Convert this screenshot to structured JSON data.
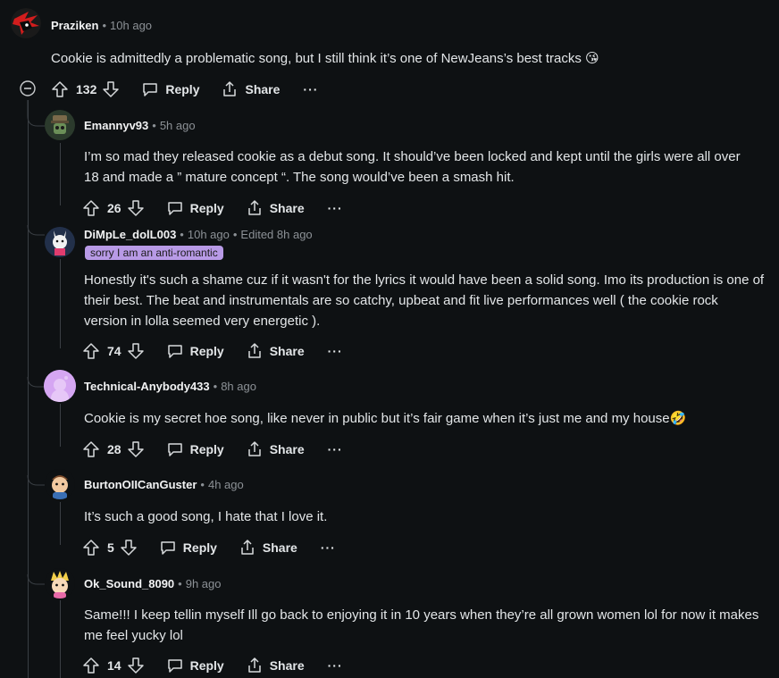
{
  "comments": [
    {
      "username": "Praziken",
      "time": "10h ago",
      "text": "Cookie is admittedly a problematic song, but I still think it’s one of NewJeans’s best tracks 😘",
      "votes": "132",
      "reply": "Reply",
      "share": "Share",
      "more": "···"
    },
    {
      "username": "Emannyv93",
      "time": "5h ago",
      "text": "I’m so mad they released cookie as a debut song. It should’ve been locked and kept until the girls were all over 18 and made a ” mature concept “. The song would’ve been a smash hit.",
      "votes": "26",
      "reply": "Reply",
      "share": "Share",
      "more": "···"
    },
    {
      "username": "DiMpLe_dolL003",
      "time": "10h ago",
      "edited": "Edited 8h ago",
      "flair": "sorry I am an anti-romantic",
      "text": "Honestly it's such a shame cuz if it wasn't for the lyrics it would have been a solid song. Imo its production is one of their best. The beat and instrumentals are so catchy, upbeat and fit live performances well ( the cookie rock version in lolla seemed very energetic ).",
      "votes": "74",
      "reply": "Reply",
      "share": "Share",
      "more": "···"
    },
    {
      "username": "Technical-Anybody433",
      "time": "8h ago",
      "text": "Cookie is my secret hoe song, like never in public but it’s fair game when it’s just me and my house🤣",
      "votes": "28",
      "reply": "Reply",
      "share": "Share",
      "more": "···"
    },
    {
      "username": "BurtonOIICanGuster",
      "time": "4h ago",
      "text": "It’s such a good song, I hate that I love it.",
      "votes": "5",
      "reply": "Reply",
      "share": "Share",
      "more": "···"
    },
    {
      "username": "Ok_Sound_8090",
      "time": "9h ago",
      "text": "Same!!! I keep tellin myself Ill go back to enjoying it in 10 years when they’re all grown women lol for now it makes me feel yucky lol",
      "votes": "14",
      "reply": "Reply",
      "share": "Share",
      "more": "···"
    }
  ],
  "colors": {
    "background": "#0e1113",
    "text": "#e3e6e8",
    "meta": "#8c9196",
    "thread_line": "#3a3f44",
    "flair_bg": "#b89ae6"
  },
  "icons": [
    "avatar",
    "upvote-icon",
    "downvote-icon",
    "reply-icon",
    "share-icon",
    "more-icon",
    "collapse-icon"
  ]
}
